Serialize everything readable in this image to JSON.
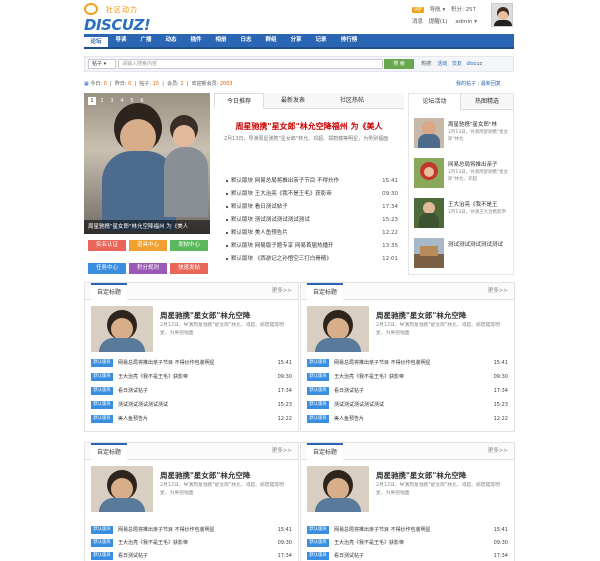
{
  "header": {
    "logo_tagline": "社区动力",
    "logo_text": "DISCUZ!",
    "vip_badge": "VIP",
    "user_menu": "导航",
    "points_label": "积分:",
    "points_value": "257",
    "messages": "消息",
    "reminders": "提醒(1)",
    "username": "admin",
    "caret": "▾"
  },
  "nav": {
    "items": [
      "论坛",
      "导读",
      "广播",
      "动态",
      "插件",
      "相册",
      "日志",
      "群组",
      "分享",
      "记录",
      "排行榜"
    ]
  },
  "search": {
    "scope": "帖子",
    "placeholder": "请输入搜索内容",
    "button": "搜 索",
    "hot_label": "热搜:",
    "hot_terms": [
      "活动",
      "交友",
      "discuz"
    ]
  },
  "stats": {
    "today_label": "今日:",
    "today": "0",
    "yesterday_label": "昨日:",
    "yesterday": "0",
    "posts_label": "帖子:",
    "posts": "15",
    "members_label": "会员:",
    "members": "2",
    "newest_label": "欢迎新会员:",
    "newest": "2003",
    "links": [
      "我的帖子",
      "最新回复"
    ]
  },
  "slideshow": {
    "numbers": [
      "1",
      "2",
      "3",
      "4",
      "5",
      "6"
    ],
    "caption": "周星驰携\"星女郎\"林允空降福州 为《美人"
  },
  "quick_buttons": [
    "实名认证",
    "道具中心",
    "发帖中心",
    "任务中心",
    "积分规则",
    "快速发帖"
  ],
  "middle": {
    "tabs": [
      "今日推荐",
      "最新发表",
      "社区热帖"
    ],
    "headline": "周星驰携\"星女郎\"林允空降福州 为《美人",
    "summary": "2月13日，导演周星驰携\"星女郎\"林允、邓超、郑蔚蕴等明星，为男别福面",
    "list": [
      {
        "text": "默认版块  网易总局将推出亲子节目 不得炒作 ",
        "time": "15:41"
      },
      {
        "text": "默认版块  王大治亮《我不是王毛》获影帝",
        "time": "09:30"
      },
      {
        "text": "默认版块  看日测试帖子",
        "time": "17:34"
      },
      {
        "text": "默认版块  测试测试测试测试测试",
        "time": "15:23"
      },
      {
        "text": "默认版块  美人鱼预告片",
        "time": "12:22"
      },
      {
        "text": "默认版块  网易版子题专享 网易首届热播开",
        "time": "13:35"
      },
      {
        "text": "默认版块  《西游记之孙悟空三打白骨精》",
        "time": "12:01"
      }
    ]
  },
  "right": {
    "tabs": [
      "论坛活动",
      "热图精选"
    ],
    "items": [
      {
        "title": "周星驰携\"星女郎\"林",
        "desc": "2月13日，导演周星驰携\"星女郎\"林允"
      },
      {
        "title": "网易总局将推出亲子",
        "desc": "2月13日，导演周星驰携\"星女郎\"林允、邓超"
      },
      {
        "title": "王大治亮《我不是王",
        "desc": "2月13日，导演王大治携影帝"
      },
      {
        "title": "测试测试测试测试测试",
        "desc": ""
      }
    ]
  },
  "boxes": [
    {
      "title": "自定标题",
      "more": "更多>>",
      "headline": "周星驰携\"星女郎\"林允空降",
      "desc": "2月13日，导演周星驰携\"星女郎\"林允、邓超、郑蔚蕴等明星，为男别福面",
      "rows": [
        {
          "tag": "默认版块",
          "text": "网易总局将推出亲子节目 不得炒作包装明星",
          "time": "15:41"
        },
        {
          "tag": "默认版块",
          "text": "王大治亮《我不是王毛》获影帝",
          "time": "09:30"
        },
        {
          "tag": "默认版块",
          "text": "看日测试帖子",
          "time": "17:34"
        },
        {
          "tag": "默认版块",
          "text": "测试测试测试测试测试",
          "time": "15:23"
        },
        {
          "tag": "默认版块",
          "text": "美人鱼预告片",
          "time": "12:22"
        }
      ]
    },
    {
      "title": "自定标题",
      "more": "更多>>",
      "headline": "周星驰携\"星女郎\"林允空降",
      "desc": "2月13日，导演周星驰携\"星女郎\"林允、邓超、郑蔚蕴等明星，为男别福面",
      "rows": [
        {
          "tag": "默认版块",
          "text": "网易总局将推出亲子节目 不得炒作包装明星",
          "time": "15:41"
        },
        {
          "tag": "默认版块",
          "text": "王大治亮《我不是王毛》获影帝",
          "time": "09:30"
        },
        {
          "tag": "默认版块",
          "text": "看日测试帖子",
          "time": "17:34"
        },
        {
          "tag": "默认版块",
          "text": "测试测试测试测试测试",
          "time": "15:23"
        },
        {
          "tag": "默认版块",
          "text": "美人鱼预告片",
          "time": "12:22"
        }
      ]
    },
    {
      "title": "自定标题",
      "more": "更多>>",
      "headline": "周星驰携\"星女郎\"林允空降",
      "desc": "2月13日，导演周星驰携\"星女郎\"林允、邓超、郑蔚蕴等明星，为男别福面",
      "rows": [
        {
          "tag": "默认版块",
          "text": "网易总局将推出亲子节目 不得炒作包装明星",
          "time": "15:41"
        },
        {
          "tag": "默认版块",
          "text": "王大治亮《我不是王毛》获影帝",
          "time": "09:30"
        },
        {
          "tag": "默认版块",
          "text": "看日测试帖子",
          "time": "17:34"
        }
      ]
    },
    {
      "title": "自定标题",
      "more": "更多>>",
      "headline": "周星驰携\"星女郎\"林允空降",
      "desc": "2月13日，导演周星驰携\"星女郎\"林允、邓超、郑蔚蕴等明星，为男别福面",
      "rows": [
        {
          "tag": "默认版块",
          "text": "网易总局将推出亲子节目 不得炒作包装明星",
          "time": "15:41"
        },
        {
          "tag": "默认版块",
          "text": "王大治亮《我不是王毛》获影帝",
          "time": "09:30"
        },
        {
          "tag": "默认版块",
          "text": "看日测试帖子",
          "time": "17:34"
        }
      ]
    }
  ],
  "colors": {
    "brand_blue": "#2a66b4",
    "accent_orange": "#f4a21b",
    "headline_red": "#cc0000",
    "tag_blue": "#3a8ee0",
    "search_green": "#6aa84f"
  }
}
